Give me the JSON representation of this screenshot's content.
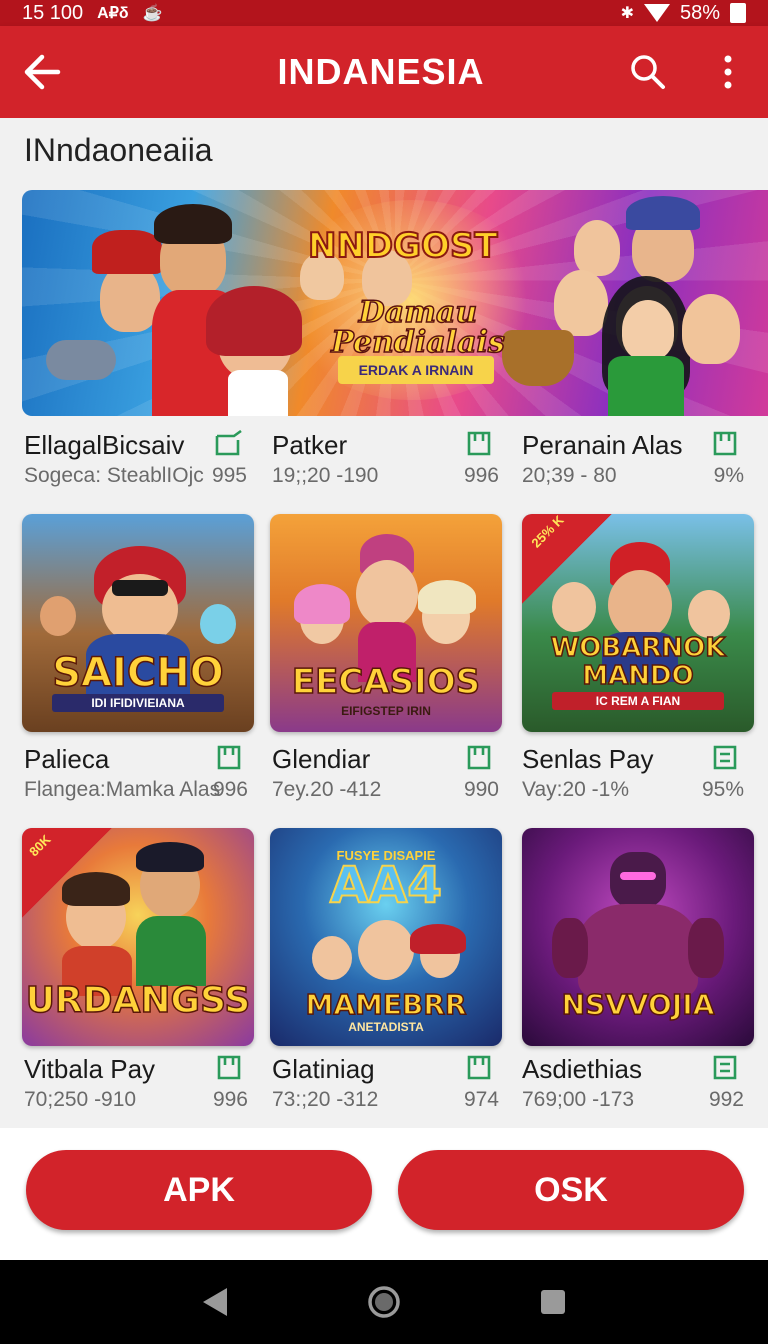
{
  "status_bar": {
    "time": "15 100",
    "extra": "A₽δ",
    "battery": "58%"
  },
  "app_bar": {
    "title": "INDANESIA",
    "back_icon": "arrow-left-icon",
    "search_icon": "search-icon",
    "menu_icon": "more-vert-icon"
  },
  "section": {
    "title": "INndaoneaiia"
  },
  "banner": {
    "logo_top": "NNDGOST",
    "logo_main": "Damau Pendialais",
    "ribbon": "ERDAK A IRNAIN"
  },
  "featured_items": [
    {
      "name": "EllagalBicsaiv",
      "sub": "Sogeca: SteablIOjc",
      "count": "995",
      "icon": "install-icon"
    },
    {
      "name": "Patker",
      "sub": "19;;20 -190",
      "count": "996",
      "icon": "install-icon"
    },
    {
      "name": "Peranain Alas",
      "sub": "20;39 - 80",
      "count": "9%",
      "icon": "install-icon"
    }
  ],
  "grid": [
    {
      "art_title": "SAICHO",
      "art_sub": "IDI IFIDIVIEIANA",
      "corner": "",
      "name": "Palieca",
      "sub": "Flangea:Mamka Alas",
      "count": "996",
      "icon": "install-icon"
    },
    {
      "art_title": "EECASIOS",
      "art_sub": "EIFIGSTEP IRIN",
      "corner": "",
      "name": "Glendiar",
      "sub": "7ey.20 -412",
      "count": "990",
      "icon": "install-icon"
    },
    {
      "art_title": "WOBARNOK MANDO",
      "art_sub": "IC REM A FIAN",
      "corner": "25% K",
      "name": "Senlas Pay",
      "sub": "Vay:20 -1%",
      "count": "95%",
      "icon": "list-icon"
    },
    {
      "art_title": "URDANGSS",
      "art_sub": "",
      "corner": "80K",
      "name": "Vitbala Pay",
      "sub": "70;250 -910",
      "count": "996",
      "icon": "install-icon"
    },
    {
      "art_title": "MAMEBRR",
      "art_sub": "ANETADISTA",
      "corner": "",
      "name": "Glatiniag",
      "sub": "73:;20 -312",
      "count": "974",
      "icon": "install-icon"
    },
    {
      "art_title": "NSVVOJIA",
      "art_sub": "",
      "corner": "",
      "name": "Asdiethias",
      "sub": "769;00 -173",
      "count": "992",
      "icon": "list-icon"
    }
  ],
  "grid_top_titles": {
    "card5_top": "FUSYE DISAPIE",
    "card5_big": "AA4"
  },
  "buttons": {
    "left": "APK",
    "right": "OSK"
  },
  "colors": {
    "primary": "#d2232a",
    "status_bar": "#b3141c",
    "accent_green": "#2a9a5a"
  }
}
